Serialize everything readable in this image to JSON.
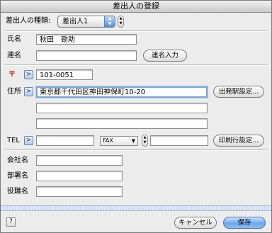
{
  "window": {
    "title": "差出人の登録"
  },
  "sender_type": {
    "label": "差出人の種類:",
    "selected": "差出人1"
  },
  "name": {
    "label": "氏名",
    "value": "秋田　勘助"
  },
  "joint_name": {
    "label": "連名",
    "value": "",
    "button": "連名入力"
  },
  "postal": {
    "label": "〒",
    "value": "101-0051"
  },
  "address": {
    "label": "住所",
    "line1": "東京都千代田区神田神保町10-20",
    "line2": "",
    "line3": "",
    "button": "出発駅設定..."
  },
  "tel": {
    "label": "TEL",
    "value": "",
    "fax_type": "FAX",
    "fax_value": "",
    "button": "印刷行設定..."
  },
  "company": {
    "label": "会社名",
    "value": ""
  },
  "department": {
    "label": "部署名",
    "value": ""
  },
  "title": {
    "label": "役職名",
    "value": ""
  },
  "footer": {
    "help": "?",
    "cancel": "キャンセル",
    "save": "保存"
  },
  "icons": {
    "arrow": "right-arrow-icon",
    "stepper": "up-down-stepper-icon"
  }
}
